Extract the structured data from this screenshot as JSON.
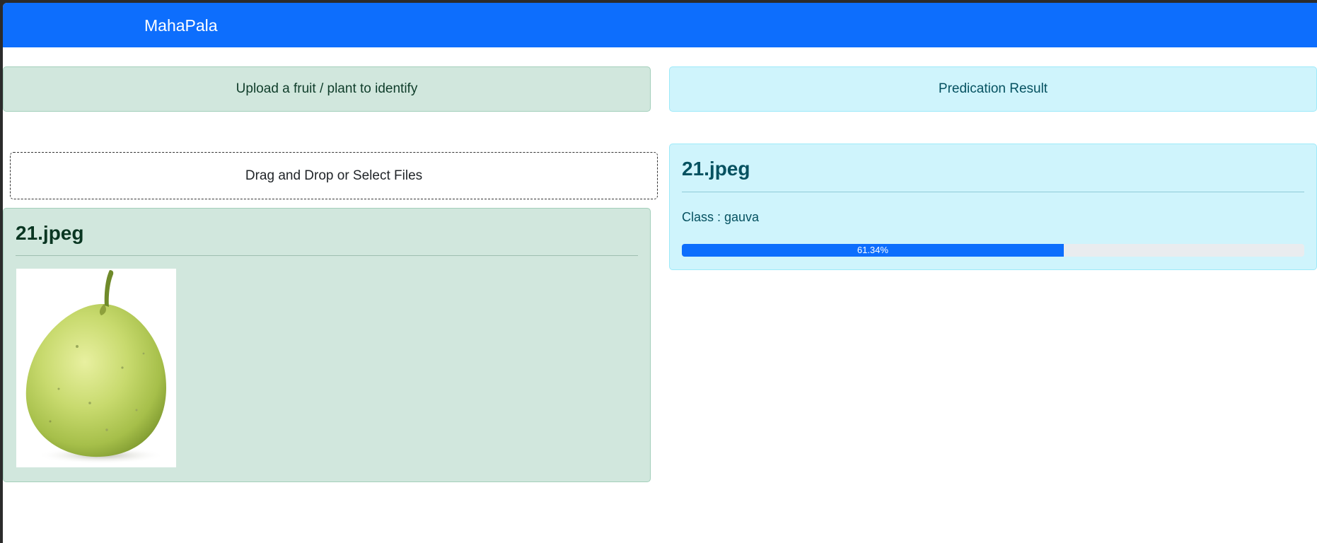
{
  "navbar": {
    "brand": "MahaPala",
    "color": "#0d6efd"
  },
  "upload_panel": {
    "header": "Upload a fruit / plant to identify",
    "dropzone_label": "Drag and Drop or Select Files",
    "card": {
      "title": "21.jpeg",
      "image_alt": "guava"
    }
  },
  "result_panel": {
    "header": "Predication Result",
    "card": {
      "title": "21.jpeg",
      "class_text": "Class : gauva",
      "confidence_label": "61.34%",
      "confidence_percent": 61.34
    }
  },
  "colors": {
    "success_bg": "#d1e7dd",
    "info_bg": "#cff4fc",
    "primary": "#0d6efd"
  },
  "icons": {
    "preview_image": "guava-photo"
  }
}
